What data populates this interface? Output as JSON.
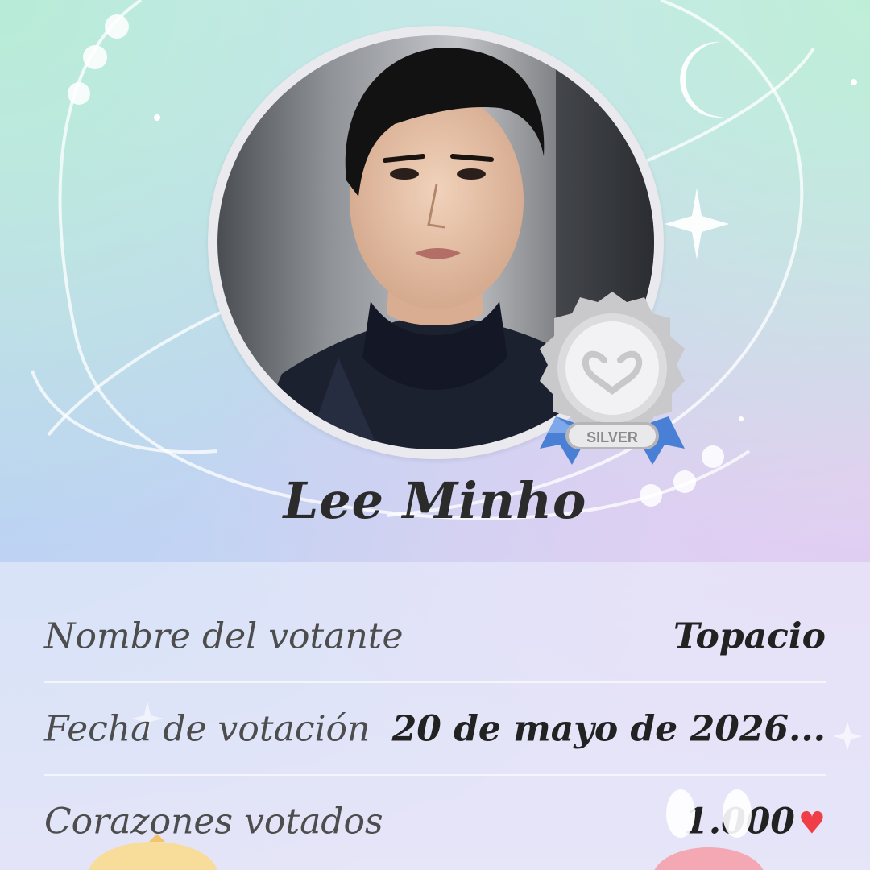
{
  "profile": {
    "name": "Lee Minho",
    "badge_label": "SILVER"
  },
  "details": [
    {
      "label": "Nombre del votante",
      "value": "Topacio"
    },
    {
      "label": "Fecha de votación",
      "value": "20 de mayo de 2026..."
    },
    {
      "label": "Corazones votados",
      "value": "1.000"
    }
  ],
  "icons": {
    "heart": "heart-icon",
    "moon": "crescent-moon-icon",
    "sparkle": "sparkle-icon",
    "medal": "silver-medal-icon"
  },
  "colors": {
    "heart": "#ef3e48",
    "badge_ribbon": "#4a7fd6",
    "badge_silver": "#c9c9cc"
  }
}
